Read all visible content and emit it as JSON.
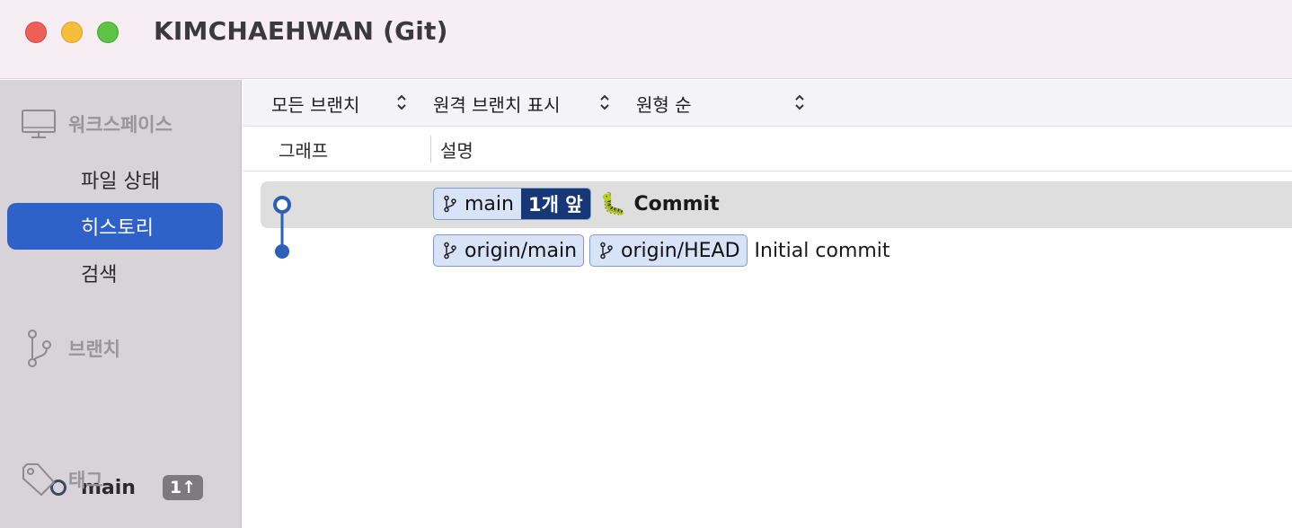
{
  "window": {
    "title": "KIMCHAEHWAN (Git)"
  },
  "sidebar": {
    "workspace": {
      "label": "워크스페이스",
      "icon": "monitor-icon",
      "items": [
        {
          "label": "파일 상태",
          "active": false
        },
        {
          "label": "히스토리",
          "active": true
        },
        {
          "label": "검색",
          "active": false
        }
      ]
    },
    "branches": {
      "label": "브랜치",
      "icon": "branch-icon",
      "items": [
        {
          "name": "main",
          "badge": "1↑"
        }
      ]
    },
    "tags": {
      "label": "태그",
      "icon": "tag-icon"
    }
  },
  "toolbar": {
    "branch_filter": "모든 브랜치",
    "remote_filter": "원격 브랜치 표시",
    "order": "원형 순"
  },
  "columns": {
    "graph": "그래프",
    "description": "설명"
  },
  "commits": [
    {
      "refs": [
        {
          "name": "main",
          "ahead": "1개 앞"
        }
      ],
      "emoji": "🐛",
      "message": "Commit",
      "selected": true
    },
    {
      "refs": [
        {
          "name": "origin/main"
        },
        {
          "name": "origin/HEAD"
        }
      ],
      "message": "Initial commit",
      "selected": false
    }
  ],
  "colors": {
    "accent": "#2f62c9",
    "graph_line": "#2c5fb7",
    "ahead_badge": "#163876",
    "ref_tag_bg": "#d8e3f8"
  }
}
